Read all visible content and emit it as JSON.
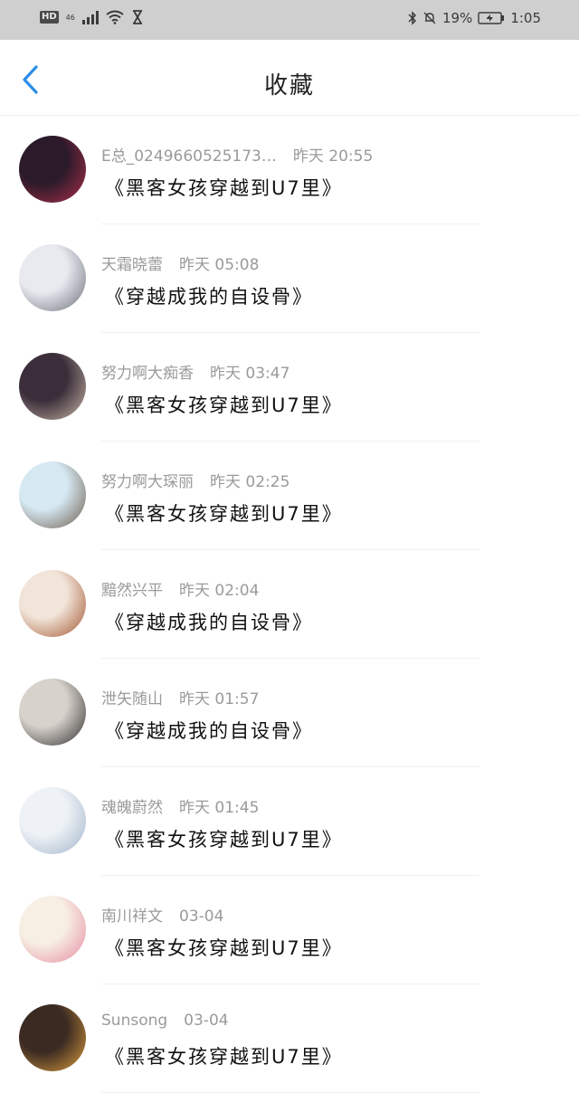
{
  "status_bar": {
    "hd": "HD",
    "network": "46",
    "battery": "19%",
    "time": "1:05"
  },
  "header": {
    "title": "收藏",
    "back_icon": "chevron-left-icon"
  },
  "accent_color": "#2b8ee8",
  "favorites": [
    {
      "user": "E总_0249660525173…",
      "time": "昨天 20:55",
      "title": "《黑客女孩穿越到U7里》",
      "avatar_colors": [
        "#2a1a2a",
        "#b0304a"
      ]
    },
    {
      "user": "天霜晓蕾",
      "time": "昨天 05:08",
      "title": "《穿越成我的自设骨》",
      "avatar_colors": [
        "#e8eaf0",
        "#6b6f78"
      ]
    },
    {
      "user": "努力啊大痴香",
      "time": "昨天 03:47",
      "title": "《黑客女孩穿越到U7里》",
      "avatar_colors": [
        "#3b2e3a",
        "#c9b9a8"
      ]
    },
    {
      "user": "努力啊大琛丽",
      "time": "昨天 02:25",
      "title": "《黑客女孩穿越到U7里》",
      "avatar_colors": [
        "#d6e8f2",
        "#6a5a4a"
      ]
    },
    {
      "user": "黯然兴平",
      "time": "昨天 02:04",
      "title": "《穿越成我的自设骨》",
      "avatar_colors": [
        "#f1e4d8",
        "#a0522d"
      ]
    },
    {
      "user": "泄矢随山",
      "time": "昨天 01:57",
      "title": "《穿越成我的自设骨》",
      "avatar_colors": [
        "#d8d2cc",
        "#2b2b2b"
      ]
    },
    {
      "user": "魂魄蔚然",
      "time": "昨天 01:45",
      "title": "《黑客女孩穿越到U7里》",
      "avatar_colors": [
        "#eef2f6",
        "#9fb3c8"
      ]
    },
    {
      "user": "南川祥文",
      "time": "03-04",
      "title": "《黑客女孩穿越到U7里》",
      "avatar_colors": [
        "#f7efe4",
        "#e68aa0"
      ]
    },
    {
      "user": "Sunsong",
      "time": "03-04",
      "title": "《黑客女孩穿越到U7里》",
      "avatar_colors": [
        "#3a2a22",
        "#e0a040"
      ]
    }
  ]
}
